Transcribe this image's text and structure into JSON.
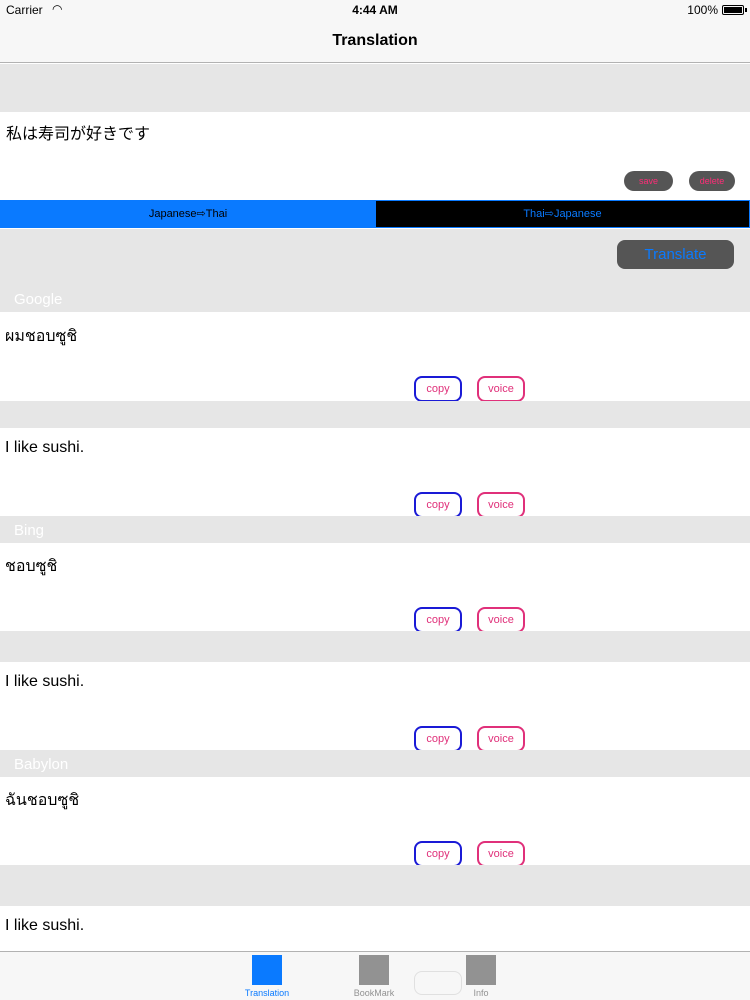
{
  "status_bar": {
    "carrier": "Carrier",
    "time": "4:44 AM",
    "battery": "100%"
  },
  "nav": {
    "title": "Translation"
  },
  "input": {
    "text": "私は寿司が好きです",
    "save_label": "save",
    "delete_label": "delete"
  },
  "direction": {
    "left_label": "Japanese⇨Thai",
    "right_label": "Thai⇨Japanese",
    "selected": "Japanese⇨Thai"
  },
  "translate_label": "Translate",
  "result_buttons": {
    "copy": "copy",
    "voice": "voice"
  },
  "sections": [
    {
      "name": "Google",
      "results": [
        "ผมชอบซูชิ",
        "I like sushi."
      ]
    },
    {
      "name": "Bing",
      "results": [
        "ชอบซูชิ",
        "I like sushi."
      ]
    },
    {
      "name": "Babylon",
      "results": [
        "ฉันชอบซูชิ",
        "I like sushi."
      ]
    }
  ],
  "tabs": [
    {
      "label": "Translation",
      "active": true
    },
    {
      "label": "BookMark",
      "active": false
    },
    {
      "label": "Info",
      "active": false
    }
  ],
  "colors": {
    "accent": "#0a7aff",
    "pink": "#e0307a",
    "copy_border": "#1a1ad6",
    "section_bg": "#e6e6e6"
  }
}
